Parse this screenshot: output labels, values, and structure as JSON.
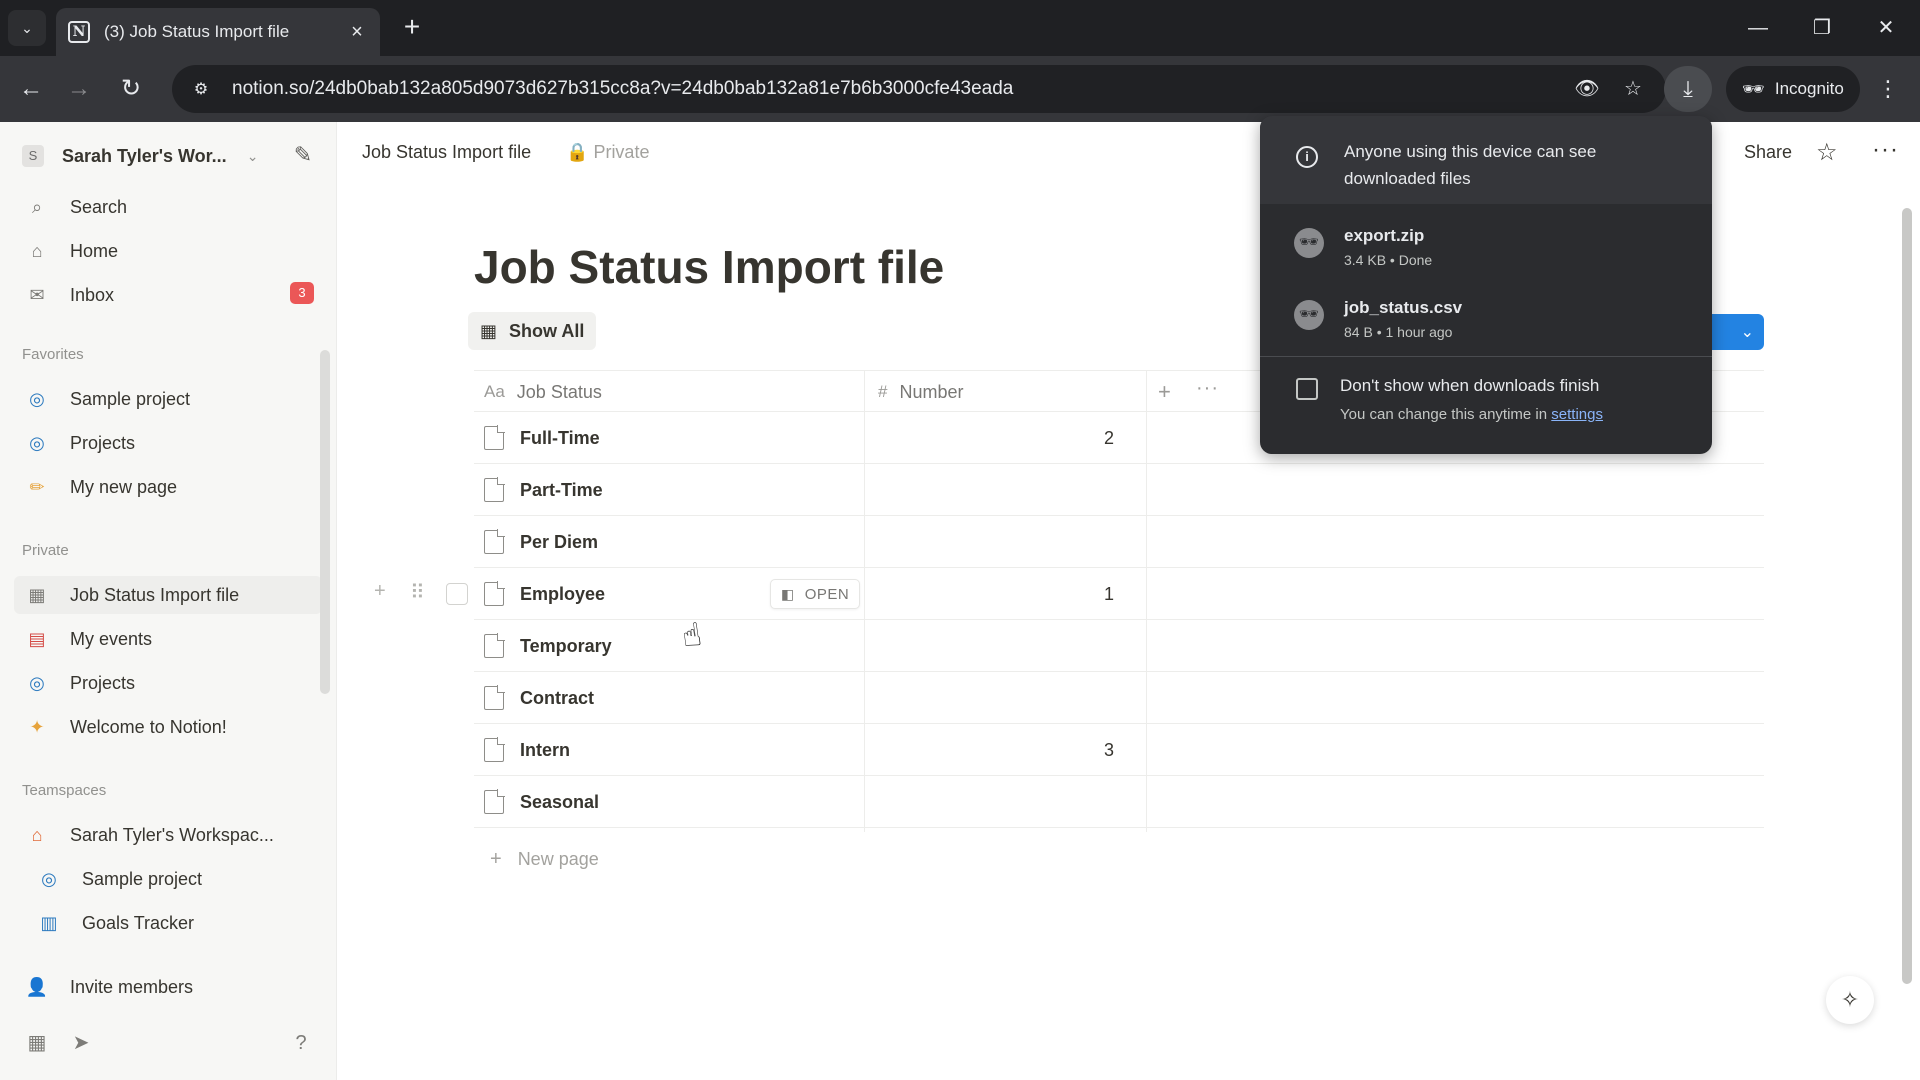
{
  "browser": {
    "tab_title": "(3) Job Status Import file",
    "tab_favicon": "N",
    "url": "notion.so/24db0bab132a805d9073d627b315cc8a?v=24db0bab132a81e7b6b3000cfe43eada",
    "incognito_label": "Incognito"
  },
  "sidebar": {
    "workspace_initial": "S",
    "workspace_name": "Sarah Tyler's Wor...",
    "top_items": [
      {
        "label": "Search",
        "icon": "search-icon"
      },
      {
        "label": "Home",
        "icon": "home-icon"
      },
      {
        "label": "Inbox",
        "icon": "inbox-icon",
        "badge": "3"
      }
    ],
    "favorites_label": "Favorites",
    "favorites": [
      {
        "label": "Sample project",
        "icon": "project-icon"
      },
      {
        "label": "Projects",
        "icon": "project-icon"
      },
      {
        "label": "My new page",
        "icon": "pencil-icon"
      }
    ],
    "private_label": "Private",
    "private": [
      {
        "label": "Job Status Import file",
        "icon": "table-icon",
        "active": true
      },
      {
        "label": "My events",
        "icon": "calendar-icon"
      },
      {
        "label": "Projects",
        "icon": "project-icon"
      },
      {
        "label": "Welcome to Notion!",
        "icon": "sparkle-icon"
      }
    ],
    "teamspaces_label": "Teamspaces",
    "teamspaces": [
      {
        "label": "Sarah Tyler's Workspac...",
        "icon": "house-icon"
      },
      {
        "label": "Sample project",
        "icon": "project-icon"
      },
      {
        "label": "Goals Tracker",
        "icon": "chart-icon"
      }
    ],
    "invite_label": "Invite members"
  },
  "topbar": {
    "breadcrumb": "Job Status Import file",
    "privacy": "Private",
    "share_label": "Share"
  },
  "page": {
    "title": "Job Status Import file",
    "view_tab": "Show All",
    "columns": [
      {
        "label": "Job Status",
        "icon": "Aa"
      },
      {
        "label": "Number",
        "icon": "#"
      }
    ],
    "rows": [
      {
        "name": "Full-Time",
        "number": "2"
      },
      {
        "name": "Part-Time",
        "number": ""
      },
      {
        "name": "Per Diem",
        "number": ""
      },
      {
        "name": "Employee",
        "number": "1"
      },
      {
        "name": "Temporary",
        "number": ""
      },
      {
        "name": "Contract",
        "number": ""
      },
      {
        "name": "Intern",
        "number": "3"
      },
      {
        "name": "Seasonal",
        "number": ""
      }
    ],
    "open_label": "OPEN",
    "new_page_label": "New page"
  },
  "downloads": {
    "info": "Anyone using this device can see downloaded files",
    "items": [
      {
        "name": "export.zip",
        "meta": "3.4 KB • Done"
      },
      {
        "name": "job_status.csv",
        "meta": "84 B • 1 hour ago"
      }
    ],
    "checkbox_label": "Don't show when downloads finish",
    "note_prefix": "You can change this anytime in",
    "note_link": "settings"
  },
  "colors": {
    "accent": "#2383e2",
    "badge": "#eb5757",
    "link": "#8ab4f8"
  }
}
